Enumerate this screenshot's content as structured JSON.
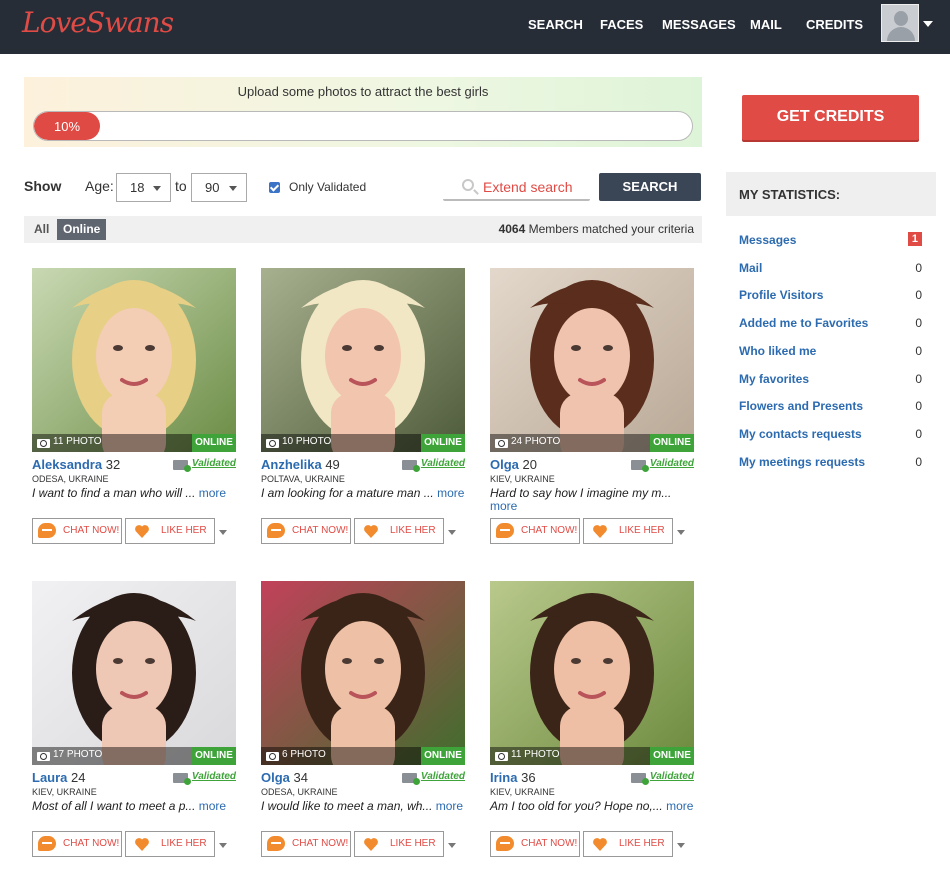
{
  "header": {
    "logo": "LoveSwans",
    "nav": [
      "SEARCH",
      "FACES",
      "MESSAGES",
      "MAIL",
      "CREDITS"
    ]
  },
  "upload": {
    "text": "Upload some photos to attract the best girls",
    "progress_label": "10%",
    "progress_fraction": 0.1
  },
  "filter": {
    "show_label": "Show",
    "age_label": "Age:",
    "age_from": "18",
    "to_label": "to",
    "age_to": "90",
    "only_validated_label": "Only Validated",
    "only_validated_checked": true,
    "extend_search_label": "Extend search",
    "search_button": "SEARCH"
  },
  "tabs": {
    "all": "All",
    "online": "Online",
    "matched_count": "4064",
    "matched_text": " Members matched your criteria"
  },
  "colors": {
    "accent": "#e14b45",
    "link": "#2c6bb0",
    "online": "#3ea43a",
    "header_bg": "#262d37"
  },
  "members": [
    {
      "name": "Aleksandra",
      "age": "32",
      "location": "ODESA, UKRAINE",
      "photos": "11 PHOTO",
      "status": "ONLINE",
      "validated": "Validated",
      "desc": "I want to find a man who will ...",
      "more": "more",
      "chat": "CHAT NOW!",
      "like": "LIKE HER",
      "hair": "#e7cf86",
      "bg1": "#6b8c45",
      "bg2": "#c9d9b3",
      "skin": "#f3cdb4"
    },
    {
      "name": "Anzhelika",
      "age": "49",
      "location": "POLTAVA, UKRAINE",
      "photos": "10 PHOTO",
      "status": "ONLINE",
      "validated": "Validated",
      "desc": "I am looking for a mature man ...",
      "more": "more",
      "chat": "CHAT NOW!",
      "like": "LIKE HER",
      "hair": "#f2e7c4",
      "bg1": "#4e5b3a",
      "bg2": "#a7b08f",
      "skin": "#f2c5ae"
    },
    {
      "name": "Olga",
      "age": "20",
      "location": "KIEV, UKRAINE",
      "photos": "24 PHOTO",
      "status": "ONLINE",
      "validated": "Validated",
      "desc": "Hard to say how I imagine my m...",
      "more": "more",
      "chat": "CHAT NOW!",
      "like": "LIKE HER",
      "hair": "#5a2d1c",
      "bg1": "#b9a896",
      "bg2": "#e3d8cb",
      "skin": "#efc3ad"
    },
    {
      "name": "Laura",
      "age": "24",
      "location": "KIEV, UKRAINE",
      "photos": "17 PHOTO",
      "status": "ONLINE",
      "validated": "Validated",
      "desc": "Most of all I want to meet a p...",
      "more": "more",
      "chat": "CHAT NOW!",
      "like": "LIKE HER",
      "hair": "#2a1d18",
      "bg1": "#d9d9dc",
      "bg2": "#f1f1f3",
      "skin": "#efc7b5"
    },
    {
      "name": "Olga",
      "age": "34",
      "location": "ODESA, UKRAINE",
      "photos": "6 PHOTO",
      "status": "ONLINE",
      "validated": "Validated",
      "desc": "I would like to meet a man, wh...",
      "more": "more",
      "chat": "CHAT NOW!",
      "like": "LIKE HER",
      "hair": "#3a2418",
      "bg1": "#3f6e2d",
      "bg2": "#c2415a",
      "skin": "#eec1a6"
    },
    {
      "name": "Irina",
      "age": "36",
      "location": "KIEV, UKRAINE",
      "photos": "11 PHOTO",
      "status": "ONLINE",
      "validated": "Validated",
      "desc": "Am I too old for you? Hope no,...",
      "more": "more",
      "chat": "CHAT NOW!",
      "like": "LIKE HER",
      "hair": "#3b2418",
      "bg1": "#6c8a3e",
      "bg2": "#b9c98c",
      "skin": "#eebfa4"
    }
  ],
  "sidebar": {
    "get_credits": "GET CREDITS",
    "stats_title": "MY STATISTICS:",
    "stats": [
      {
        "label": "Messages",
        "value": "1",
        "badge": true
      },
      {
        "label": "Mail",
        "value": "0"
      },
      {
        "label": "Profile Visitors",
        "value": "0"
      },
      {
        "label": "Added me to Favorites",
        "value": "0"
      },
      {
        "label": "Who liked me",
        "value": "0"
      },
      {
        "label": "My favorites",
        "value": "0"
      },
      {
        "label": "Flowers and Presents",
        "value": "0"
      },
      {
        "label": "My contacts requests",
        "value": "0"
      },
      {
        "label": "My meetings requests",
        "value": "0"
      }
    ]
  }
}
